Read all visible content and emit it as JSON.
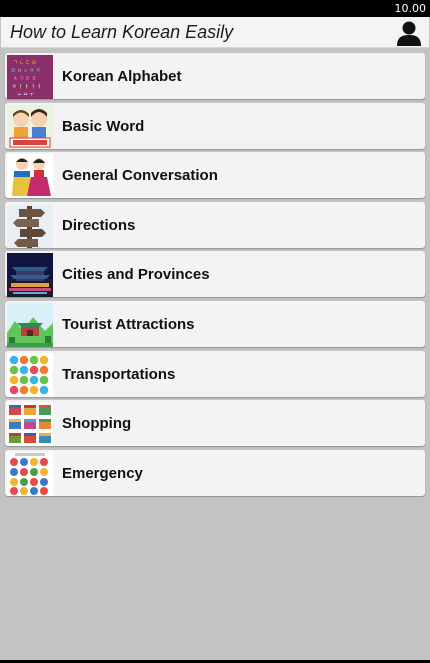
{
  "status_bar": {
    "time": "10.00"
  },
  "header": {
    "title": "How to Learn Korean Easily",
    "user_icon": "user-silhouette-icon"
  },
  "menu": {
    "items": [
      {
        "label": "Korean Alphabet",
        "icon": "korean-alphabet-thumbnail"
      },
      {
        "label": "Basic Word",
        "icon": "basic-word-thumbnail"
      },
      {
        "label": "General Conversation",
        "icon": "general-conversation-thumbnail"
      },
      {
        "label": "Directions",
        "icon": "directions-signpost-thumbnail"
      },
      {
        "label": "Cities and Provinces",
        "icon": "cities-night-thumbnail"
      },
      {
        "label": "Tourist Attractions",
        "icon": "tourist-attractions-thumbnail"
      },
      {
        "label": "Transportations",
        "icon": "transportations-thumbnail"
      },
      {
        "label": "Shopping",
        "icon": "shopping-thumbnail"
      },
      {
        "label": "Emergency",
        "icon": "emergency-thumbnail"
      }
    ]
  },
  "colors": {
    "background": "#c3c3c3",
    "row": "#f3f3f5",
    "status_bar": "#000000",
    "alphabet_thumb": "#8b2f6b"
  }
}
